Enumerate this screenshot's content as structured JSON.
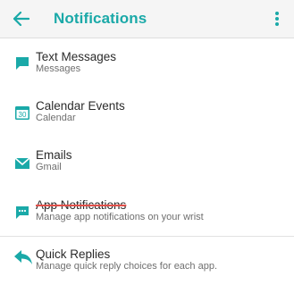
{
  "header": {
    "title": "Notifications",
    "back_icon": "arrow-left-icon",
    "more_icon": "more-vertical-icon"
  },
  "colors": {
    "accent": "#1aa9a8",
    "strike": "#e0504a"
  },
  "items": [
    {
      "label": "Text Messages",
      "sub": "Messages",
      "icon": "chat-bubble-icon"
    },
    {
      "label": "Calendar Events",
      "sub": "Calendar",
      "icon": "calendar-icon",
      "icon_text": "30"
    },
    {
      "label": "Emails",
      "sub": "Gmail",
      "icon": "envelope-icon"
    },
    {
      "label": "App Notifications",
      "sub": "Manage app notifications on your wrist",
      "icon": "chat-dots-icon"
    },
    {
      "label": "Quick Replies",
      "sub": "Manage quick reply choices for each app.",
      "icon": "reply-icon"
    }
  ]
}
